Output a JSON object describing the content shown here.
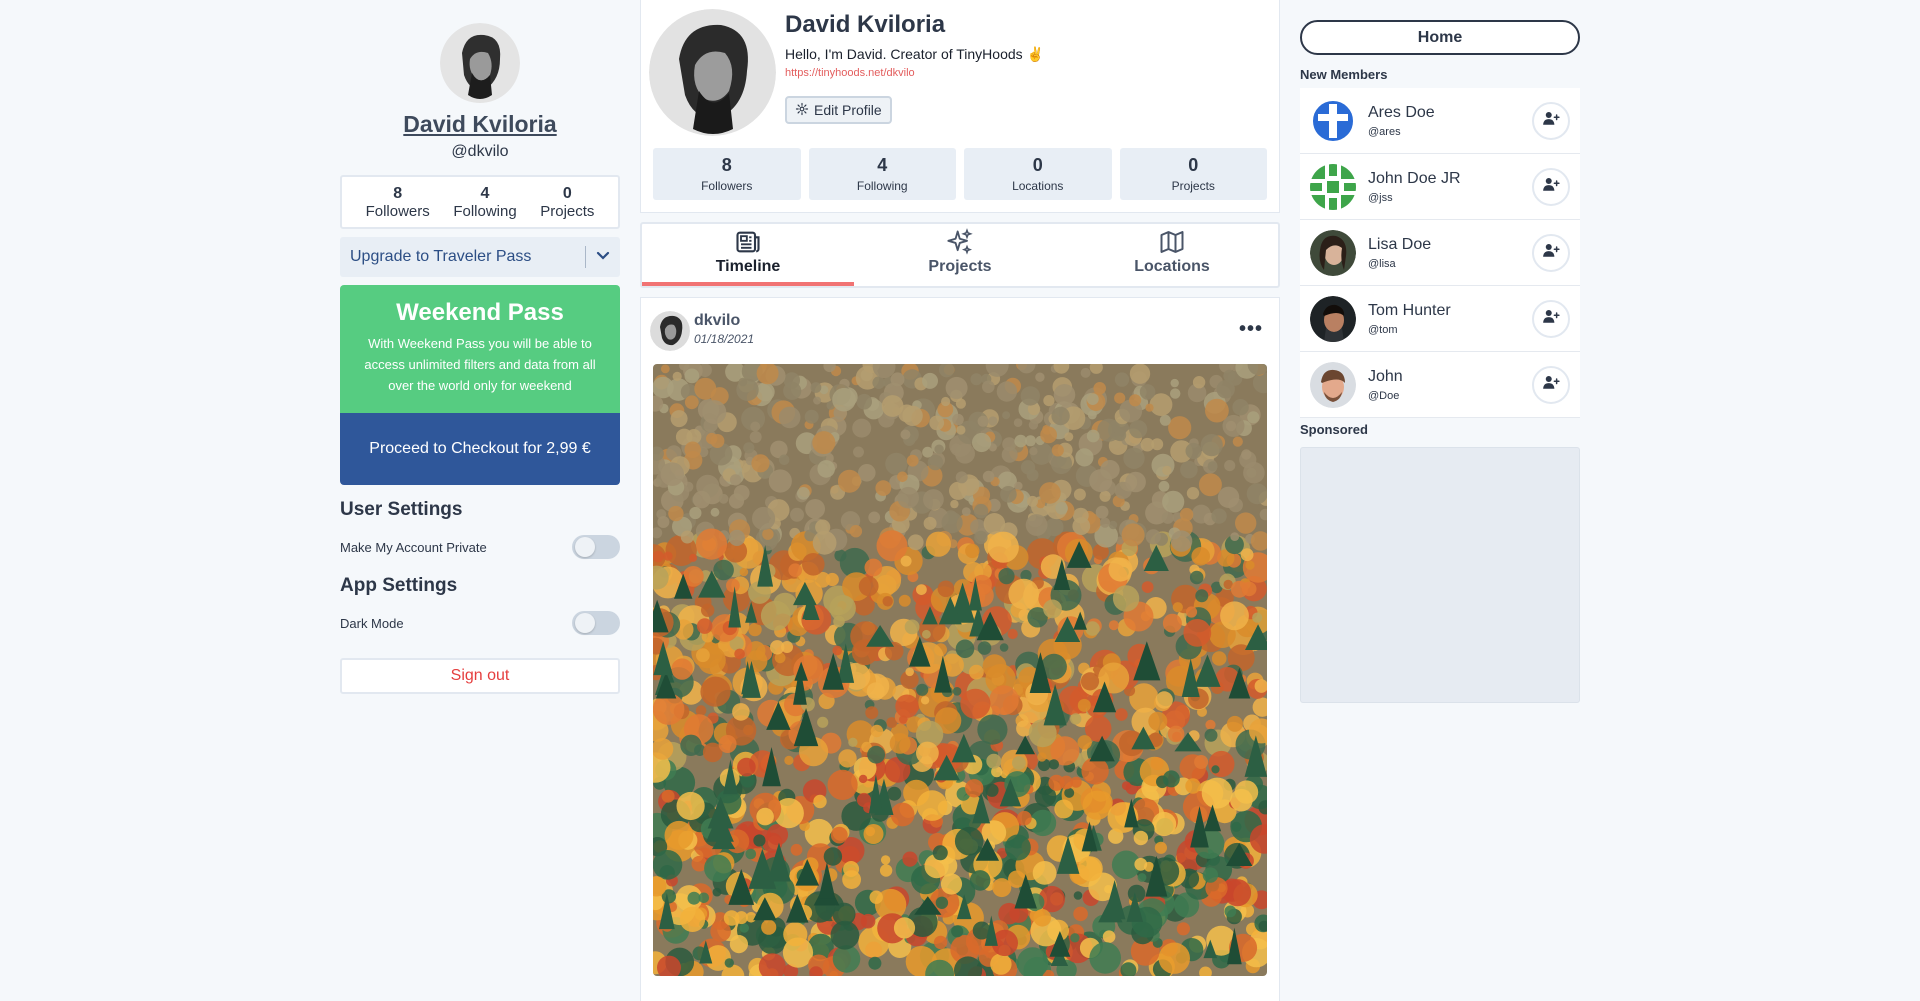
{
  "left": {
    "name": "David Kviloria",
    "handle": "@dkvilo",
    "stats": [
      {
        "value": "8",
        "label": "Followers"
      },
      {
        "value": "4",
        "label": "Following"
      },
      {
        "value": "0",
        "label": "Projects"
      }
    ],
    "upgrade_label": "Upgrade to Traveler Pass",
    "pass": {
      "title": "Weekend Pass",
      "description": "With Weekend Pass you will be able to access unlimited filters and data from all over the world only for weekend",
      "checkout_label": "Proceed to Checkout for 2,99 €"
    },
    "user_settings_title": "User Settings",
    "private_label": "Make My Account Private",
    "private_enabled": false,
    "app_settings_title": "App Settings",
    "dark_mode_label": "Dark Mode",
    "dark_mode_enabled": false,
    "signout_label": "Sign out"
  },
  "profile": {
    "name": "David Kviloria",
    "bio": "Hello, I'm David. Creator of TinyHoods ✌️",
    "link": "https://tinyhoods.net/dkvilo",
    "edit_label": "Edit Profile",
    "stats": [
      {
        "value": "8",
        "label": "Followers"
      },
      {
        "value": "4",
        "label": "Following"
      },
      {
        "value": "0",
        "label": "Locations"
      },
      {
        "value": "0",
        "label": "Projects"
      }
    ]
  },
  "tabs": [
    {
      "label": "Timeline",
      "icon": "newspaper-icon",
      "active": true
    },
    {
      "label": "Projects",
      "icon": "sparkles-icon",
      "active": false
    },
    {
      "label": "Locations",
      "icon": "map-icon",
      "active": false
    }
  ],
  "post": {
    "author": "dkvilo",
    "date": "01/18/2021",
    "more_label": "•••"
  },
  "right": {
    "home_label": "Home",
    "new_members_title": "New Members",
    "members": [
      {
        "name": "Ares Doe",
        "handle": "@ares"
      },
      {
        "name": "John Doe JR",
        "handle": "@jss"
      },
      {
        "name": "Lisa Doe",
        "handle": "@lisa"
      },
      {
        "name": "Tom Hunter",
        "handle": "@tom"
      },
      {
        "name": "John",
        "handle": "@Doe"
      }
    ],
    "sponsored_title": "Sponsored"
  },
  "colors": {
    "accent": "#f17373",
    "pass_green": "#56cc81",
    "checkout_blue": "#2f579a",
    "link_red": "#e35d5d"
  }
}
